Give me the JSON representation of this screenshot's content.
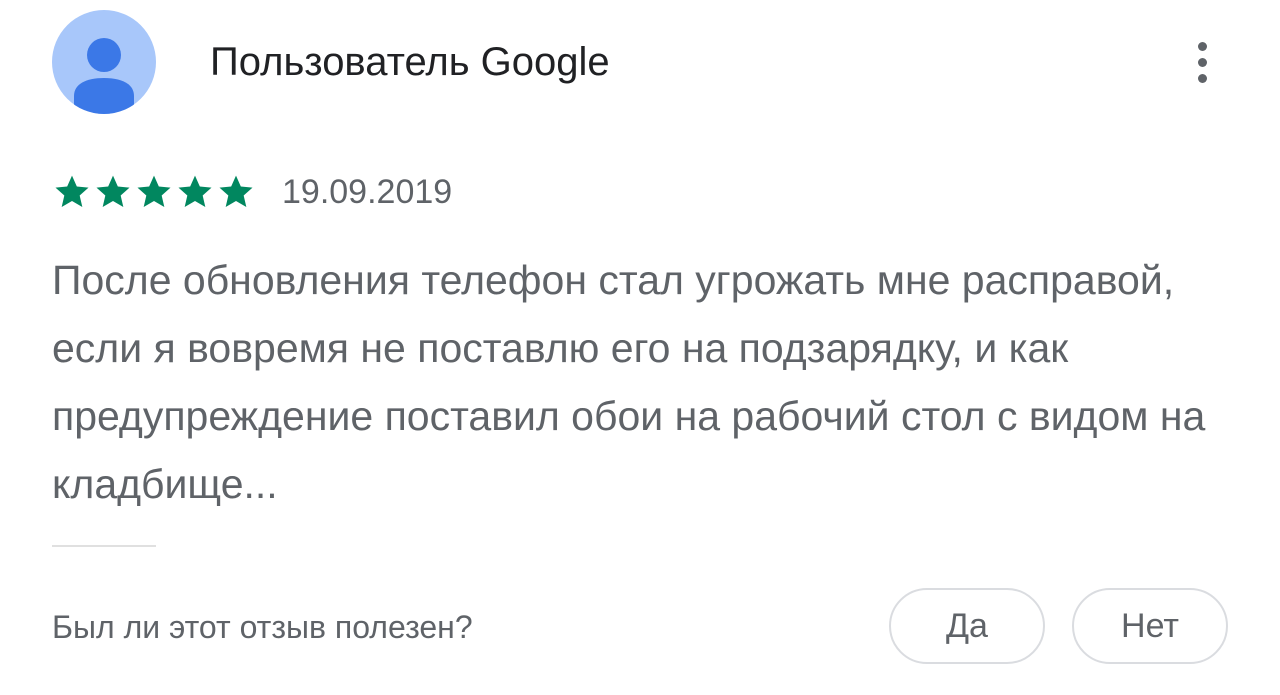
{
  "review": {
    "author": "Пользователь Google",
    "rating": 5,
    "rating_max": 5,
    "date": "19.09.2019",
    "text": "После обновления телефон стал угрожать мне расправой, если я вовремя не поставлю его на подзарядку, и как предупреждение поставил обои на рабочий стол с видом на кладбище..."
  },
  "helpful": {
    "question": "Был ли этот отзыв полезен?",
    "yes_label": "Да",
    "no_label": "Нет"
  },
  "icons": {
    "avatar": "person-icon",
    "more": "more-vert-icon",
    "star": "star-icon"
  },
  "colors": {
    "star": "#01875f",
    "avatar_bg": "#a8c7fa",
    "avatar_figure": "#3b78e7",
    "text_primary": "#202124",
    "text_secondary": "#5f6368"
  }
}
